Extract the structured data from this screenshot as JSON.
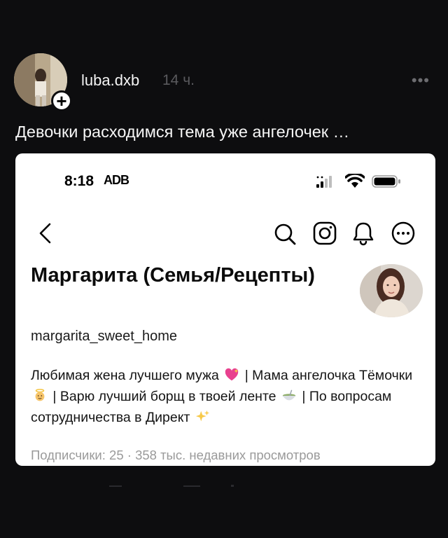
{
  "post": {
    "username": "luba.dxb",
    "timestamp": "14 ч.",
    "caption": "Девочки расходимся тема уже ангелочек …",
    "add_badge": "+",
    "more_icon": "more-horizontal-icon"
  },
  "embedded": {
    "status_bar": {
      "time": "8:18",
      "extra": "ADB"
    },
    "profile": {
      "name": "Маргарита (Семья/Рецепты)",
      "handle": "margarita_sweet_home",
      "bio_parts": [
        "Любимая жена лучшего мужа",
        "| Мама ангелочка Тёмочки",
        "| Варю лучший борщ в твоей ленте",
        "| По вопросам сотрудничества в Директ"
      ],
      "stats": "Подписчики: 25 · 358 тыс. недавних просмотров"
    }
  },
  "colors": {
    "background": "#0d0d0f",
    "card": "#ffffff",
    "muted_text": "#5a5a5e",
    "stats_text": "#9a9a9a"
  }
}
